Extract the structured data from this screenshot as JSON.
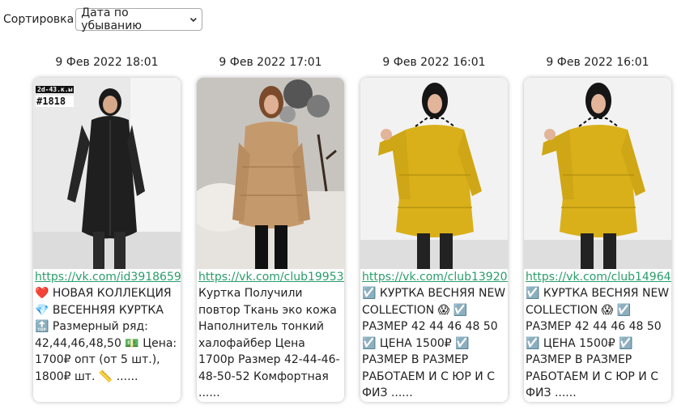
{
  "sort": {
    "label": "Сортировка",
    "selected": "Дата по убыванию"
  },
  "posts": [
    {
      "date": "9 Фев 2022 18:01",
      "link": "https://vk.com/id391865965",
      "text": "❤️ НОВАЯ КОЛЛЕКЦИЯ 💎 ВЕСЕННЯЯ КУРТКА 🔝 Размерный ряд: 42,44,46,48,50 💵 Цена: 1700₽ опт (от 5 шт.), 1800₽ шт. 📏 ......",
      "badge_small": "2d-43.к.ы",
      "badge_big": "#1818",
      "photo": "black-leather-coat"
    },
    {
      "date": "9 Фев 2022 17:01",
      "link": "https://vk.com/club199538945",
      "text": "Куртка Получили повтор Ткань эко кожа Наполнитель тонкий халофайбер Цена 1700р Размер 42-44-46-48-50-52 Комфортная ......",
      "photo": "beige-puffer-jacket"
    },
    {
      "date": "9 Фев 2022 16:01",
      "link": "https://vk.com/club139201293",
      "text": "☑️ КУРТКА ВЕСНЯЯ NEW COLLECTION 😱 ☑️ РАЗМЕР 42 44 46 48 50 ☑️ ЦЕНА 1500₽ ☑️ РАЗМЕР В РАЗМЕР РАБОТАЕМ И С ЮР И С ФИЗ ......",
      "photo": "yellow-jacket"
    },
    {
      "date": "9 Фев 2022 16:01",
      "link": "https://vk.com/club149640949",
      "text": "☑️ КУРТКА ВЕСНЯЯ NEW COLLECTION 😱 ☑️ РАЗМЕР 42 44 46 48 50 ☑️ ЦЕНА 1500₽ ☑️ РАЗМЕР В РАЗМЕР РАБОТАЕМ И С ЮР И С ФИЗ ......",
      "photo": "yellow-jacket"
    }
  ],
  "colors": {
    "link": "#2a9d6a",
    "yellow": "#d9b01a",
    "beige": "#c49a6c",
    "black": "#1c1c1c"
  }
}
